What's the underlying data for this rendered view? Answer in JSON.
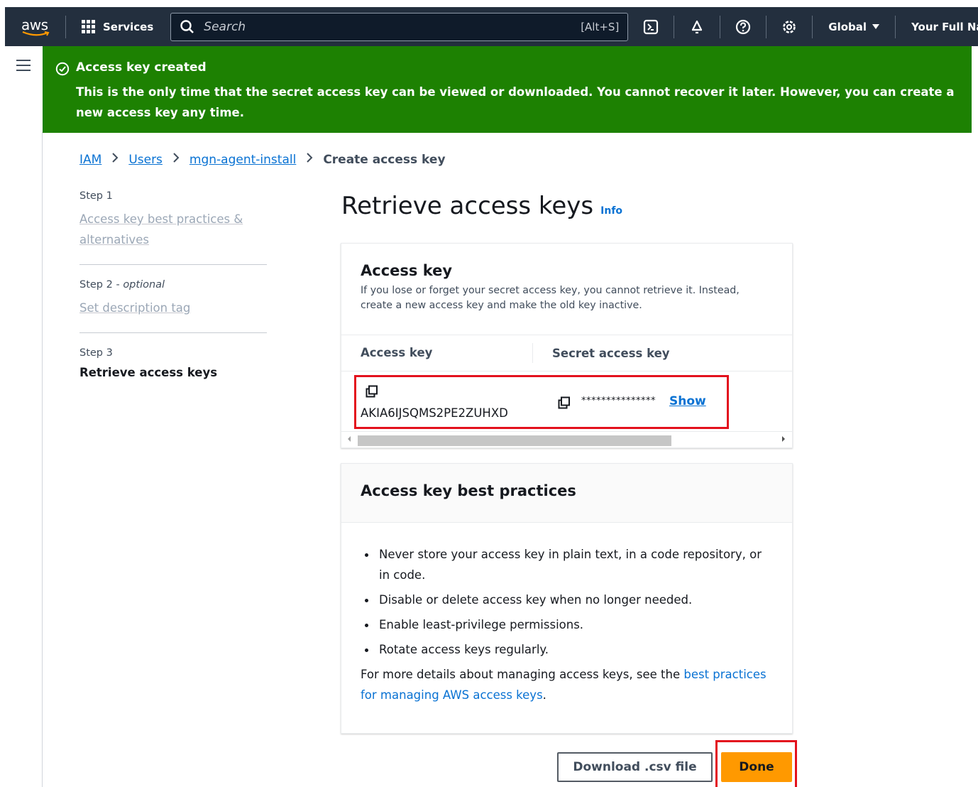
{
  "nav": {
    "logo": "aws",
    "services_label": "Services",
    "search_placeholder": "Search",
    "search_shortcut": "[Alt+S]",
    "region": "Global",
    "account": "Your Full Name"
  },
  "flash": {
    "title": "Access key created",
    "message": "This is the only time that the secret access key can be viewed or downloaded. You cannot recover it later. However, you can create a new access key any time.",
    "color": "#1d8102"
  },
  "breadcrumb": {
    "items": [
      "IAM",
      "Users",
      "mgn-agent-install"
    ],
    "current": "Create access key"
  },
  "steps": [
    {
      "label": "Step 1",
      "title": "Access key best practices & alternatives"
    },
    {
      "label": "Step 2",
      "optional": "optional",
      "title": "Set description tag"
    },
    {
      "label": "Step 3",
      "title": "Retrieve access keys"
    }
  ],
  "page": {
    "title": "Retrieve access keys",
    "info": "Info"
  },
  "access_key_panel": {
    "title": "Access key",
    "description": "If you lose or forget your secret access key, you cannot retrieve it. Instead, create a new access key and make the old key inactive.",
    "col_access_key": "Access key",
    "col_secret_key": "Secret access key",
    "access_key_value": "AKIA6IJSQMS2PE2ZUHXD",
    "secret_mask": "***************",
    "show_label": "Show"
  },
  "best_practices": {
    "title": "Access key best practices",
    "items": [
      "Never store your access key in plain text, in a code repository, or in code.",
      "Disable or delete access key when no longer needed.",
      "Enable least-privilege permissions.",
      "Rotate access keys regularly."
    ],
    "footer_prefix": "For more details about managing access keys, see the ",
    "footer_link": "best practices for managing AWS access keys",
    "footer_suffix": "."
  },
  "actions": {
    "download": "Download .csv file",
    "done": "Done"
  },
  "colors": {
    "nav_bg": "#232f3e",
    "link": "#0972d3",
    "primary": "#ff9900",
    "highlight": "#e3111d"
  }
}
